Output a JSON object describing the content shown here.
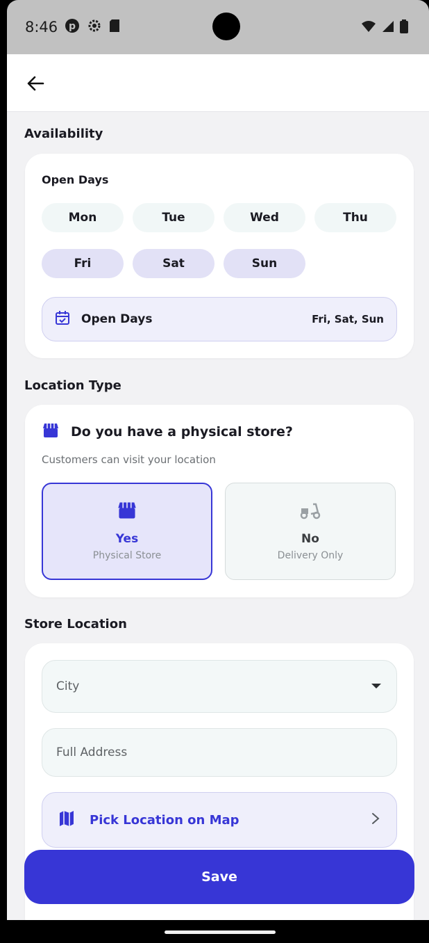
{
  "status_bar": {
    "time": "8:46"
  },
  "nav": {
    "back_label": "Back"
  },
  "availability": {
    "section_title": "Availability",
    "open_days_label": "Open Days",
    "days": [
      {
        "label": "Mon",
        "selected": false
      },
      {
        "label": "Tue",
        "selected": false
      },
      {
        "label": "Wed",
        "selected": false
      },
      {
        "label": "Thu",
        "selected": false
      },
      {
        "label": "Fri",
        "selected": true
      },
      {
        "label": "Sat",
        "selected": true
      },
      {
        "label": "Sun",
        "selected": true
      }
    ],
    "summary_label": "Open Days",
    "summary_value": "Fri, Sat, Sun"
  },
  "location_type": {
    "section_title": "Location Type",
    "question": "Do you have a physical store?",
    "subtitle": "Customers can visit your location",
    "options": [
      {
        "title": "Yes",
        "subtitle": "Physical Store",
        "selected": true
      },
      {
        "title": "No",
        "subtitle": "Delivery Only",
        "selected": false
      }
    ]
  },
  "store_location": {
    "section_title": "Store Location",
    "city_placeholder": "City",
    "address_placeholder": "Full Address",
    "map_button_label": "Pick Location on Map"
  },
  "save_label": "Save",
  "colors": {
    "accent": "#3736d6",
    "selected_chip": "#e2e1f6",
    "chip": "#f1f7f7"
  }
}
